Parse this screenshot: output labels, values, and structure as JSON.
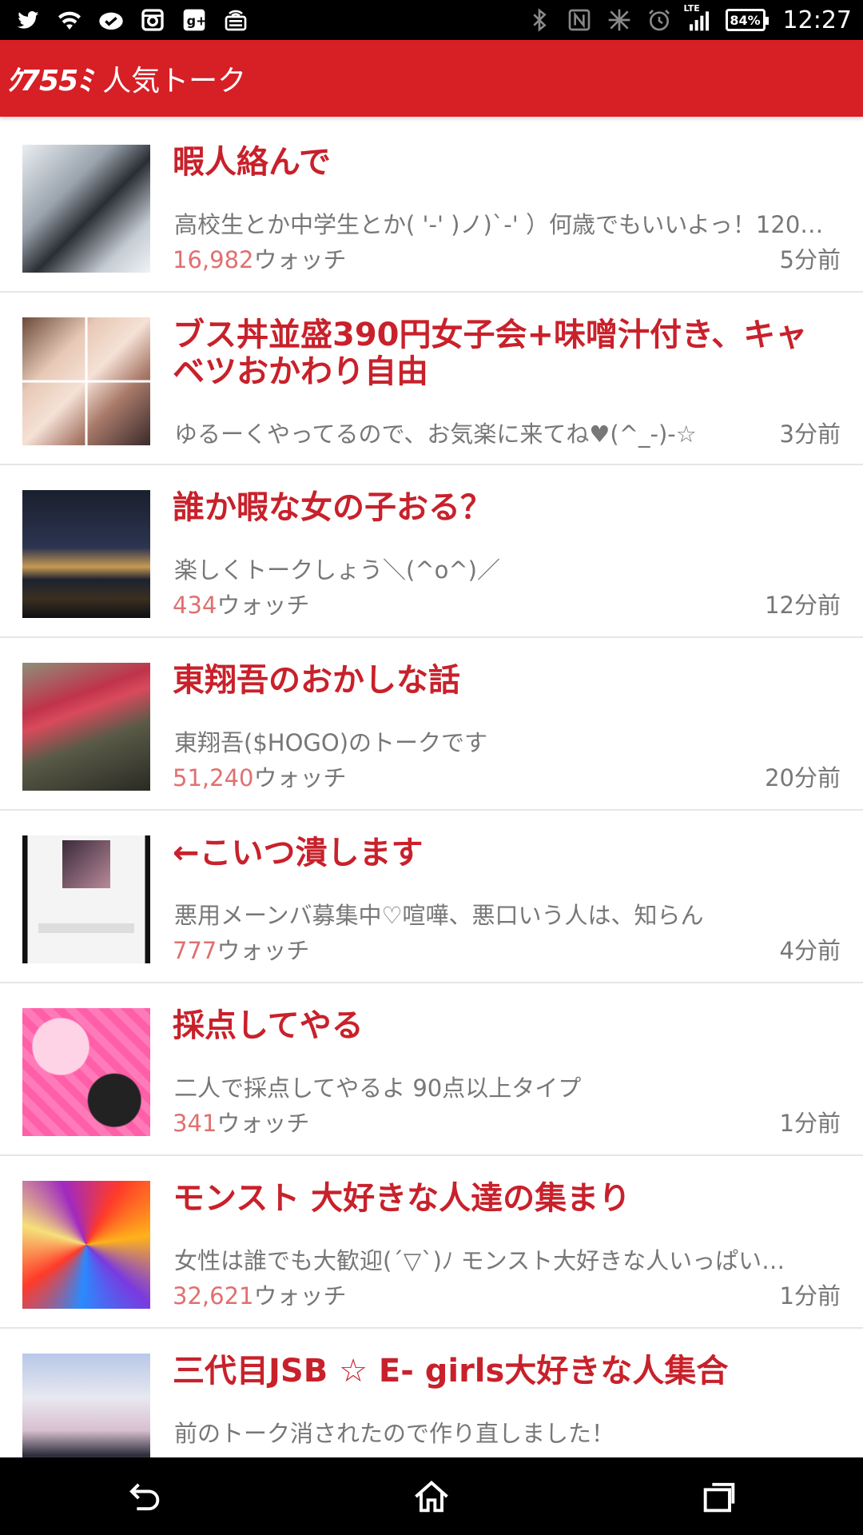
{
  "status_bar": {
    "time": "12:27",
    "battery": "84%",
    "network": "LTE",
    "left_icons": [
      "twitter-icon",
      "wifi-icon",
      "check-icon",
      "instagram-icon",
      "google-plus-icon",
      "cast-icon"
    ],
    "right_icons": [
      "bluetooth-icon",
      "nfc-icon",
      "vibrate-icon",
      "alarm-icon",
      "signal-icon"
    ]
  },
  "app_bar": {
    "logo": "ｸ755ﾐ",
    "title": "人気トーク",
    "color": "#d71f26"
  },
  "talks": [
    {
      "title": "暇人絡んで",
      "description": "高校生とか中学生とか( '-' )ノ)`-' ）何歳でもいいよっ！120…",
      "watch_count": "16,982",
      "watch_label": "ウォッチ",
      "time": "5分前"
    },
    {
      "title": "ブス丼並盛390円女子会+味噌汁付き、キャベツおかわり自由",
      "description": "ゆるーくやってるので、お気楽に来てね♥(^_-)-☆",
      "watch_count": "",
      "watch_label": "",
      "time": "3分前"
    },
    {
      "title": "誰か暇な女の子おる？",
      "description": "楽しくトークしょう＼(^o^)／",
      "watch_count": "434",
      "watch_label": "ウォッチ",
      "time": "12分前"
    },
    {
      "title": "東翔吾のおかしな話",
      "description": "東翔吾($HOGO)のトークです",
      "watch_count": "51,240",
      "watch_label": "ウォッチ",
      "time": "20分前"
    },
    {
      "title": "←こいつ潰します",
      "description": "悪用メーンバ募集中♡喧嘩、悪口いう人は、知らん",
      "watch_count": "777",
      "watch_label": "ウォッチ",
      "time": "4分前"
    },
    {
      "title": "採点してやる",
      "description": "二人で採点してやるよ 90点以上タイプ",
      "watch_count": "341",
      "watch_label": "ウォッチ",
      "time": "1分前"
    },
    {
      "title": "モンスト 大好きな人達の集まり",
      "description": "女性は誰でも大歓迎(´▽`)ﾉ モンスト大好きな人いっぱい…",
      "watch_count": "32,621",
      "watch_label": "ウォッチ",
      "time": "1分前"
    },
    {
      "title": "三代目JSB ☆ E- girls大好きな人集合",
      "description": "前のトーク消されたので作り直しました！",
      "watch_count": "",
      "watch_label": "",
      "time": ""
    }
  ],
  "nav": {
    "icons": [
      "back-icon",
      "home-icon",
      "recents-icon"
    ]
  }
}
